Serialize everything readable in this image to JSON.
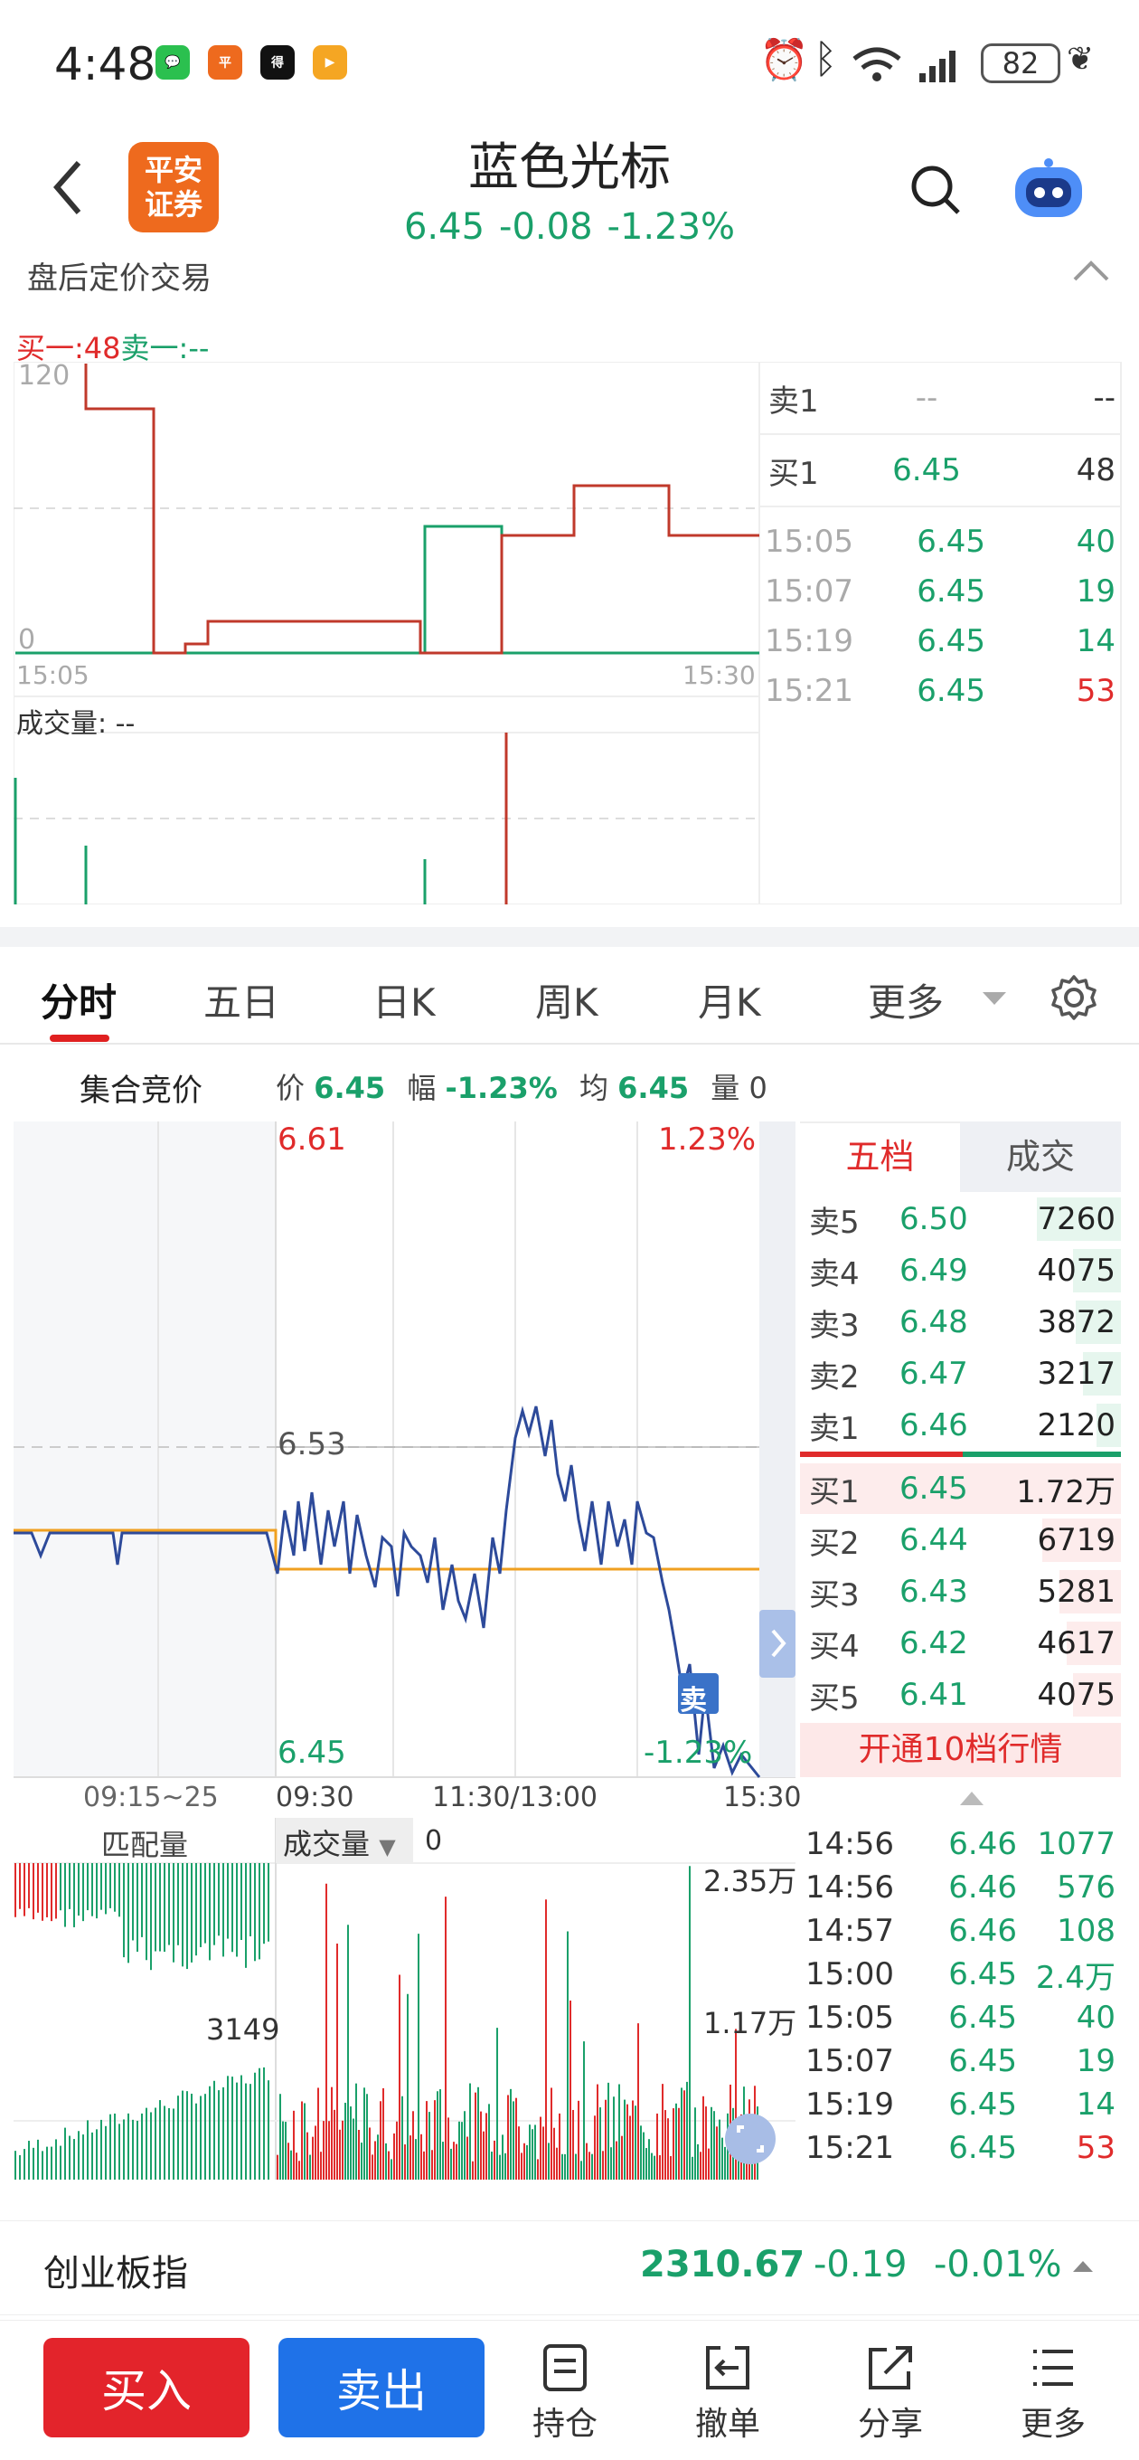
{
  "status": {
    "time": "4:48",
    "battery": "82"
  },
  "header": {
    "title": "蓝色光标",
    "price": "6.45",
    "change": "-0.08",
    "pct": "-1.23%",
    "broker_logo": "平安证券"
  },
  "after_hours": {
    "title": "盘后定价交易",
    "buy1_label": "买一:",
    "buy1_value": "48",
    "sell1_label": "卖一:",
    "sell1_value": "--",
    "y_top": "120",
    "y_bottom": "0",
    "x_start": "15:05",
    "x_end": "15:30",
    "volume_label": "成交量:",
    "volume_value": "--",
    "book": [
      {
        "label": "卖1",
        "price": "--",
        "vol": "--"
      },
      {
        "label": "买1",
        "price": "6.45",
        "vol": "48"
      }
    ],
    "trades": [
      {
        "time": "15:05",
        "price": "6.45",
        "vol": "40",
        "dir": "sell"
      },
      {
        "time": "15:07",
        "price": "6.45",
        "vol": "19",
        "dir": "sell"
      },
      {
        "time": "15:19",
        "price": "6.45",
        "vol": "14",
        "dir": "sell"
      },
      {
        "time": "15:21",
        "price": "6.45",
        "vol": "53",
        "dir": "buy"
      }
    ]
  },
  "tabs": [
    "分时",
    "五日",
    "日K",
    "周K",
    "月K",
    "更多"
  ],
  "info_bar": {
    "auction": "集合竞价",
    "price_label": "价",
    "price": "6.45",
    "amp_label": "幅",
    "amp": "-1.23%",
    "avg_label": "均",
    "avg": "6.45",
    "vol_label": "量",
    "vol": "0"
  },
  "intraday": {
    "high": "6.61",
    "high_pct": "1.23%",
    "mid": "6.53",
    "low": "6.45",
    "low_pct": "-1.23%",
    "x_labels": [
      "09:15~25",
      "09:30",
      "11:30/13:00",
      "15:30"
    ],
    "sell_marker": "卖",
    "vol_labels": {
      "match": "匹配量",
      "trade": "成交量",
      "trade_val": "0",
      "v1": "2.35万",
      "v2": "1.17万",
      "v3": "3149"
    }
  },
  "depth": {
    "tab_five": "五档",
    "tab_trades": "成交",
    "asks": [
      {
        "label": "卖5",
        "price": "6.50",
        "vol": "7260",
        "w": 0.62
      },
      {
        "label": "卖4",
        "price": "6.49",
        "vol": "4075",
        "w": 0.35
      },
      {
        "label": "卖3",
        "price": "6.48",
        "vol": "3872",
        "w": 0.33
      },
      {
        "label": "卖2",
        "price": "6.47",
        "vol": "3217",
        "w": 0.28
      },
      {
        "label": "卖1",
        "price": "6.46",
        "vol": "2120",
        "w": 0.18
      }
    ],
    "bids": [
      {
        "label": "买1",
        "price": "6.45",
        "vol": "1.72万",
        "w": 1.0
      },
      {
        "label": "买2",
        "price": "6.44",
        "vol": "6719",
        "w": 0.58
      },
      {
        "label": "买3",
        "price": "6.43",
        "vol": "5281",
        "w": 0.45
      },
      {
        "label": "买4",
        "price": "6.42",
        "vol": "4617",
        "w": 0.4
      },
      {
        "label": "买5",
        "price": "6.41",
        "vol": "4075",
        "w": 0.35
      }
    ],
    "open10": "开通10档行情"
  },
  "ticks": [
    {
      "time": "14:56",
      "price": "6.46",
      "vol": "1077"
    },
    {
      "time": "14:56",
      "price": "6.46",
      "vol": "576"
    },
    {
      "time": "14:57",
      "price": "6.46",
      "vol": "108"
    },
    {
      "time": "15:00",
      "price": "6.45",
      "vol": "2.4万"
    },
    {
      "time": "15:05",
      "price": "6.45",
      "vol": "40"
    },
    {
      "time": "15:07",
      "price": "6.45",
      "vol": "19"
    },
    {
      "time": "15:19",
      "price": "6.45",
      "vol": "14"
    },
    {
      "time": "15:21",
      "price": "6.45",
      "vol": "53",
      "red": true
    }
  ],
  "index": {
    "name": "创业板指",
    "value": "2310.67",
    "change": "-0.19",
    "pct": "-0.01%"
  },
  "bottom": {
    "buy": "买入",
    "sell": "卖出",
    "actions": [
      "持仓",
      "撤单",
      "分享",
      "更多"
    ]
  },
  "colors": {
    "up": "#e02b2b",
    "down": "#1aa06a",
    "line": "#2d4a9a",
    "avg": "#f0a020"
  }
}
